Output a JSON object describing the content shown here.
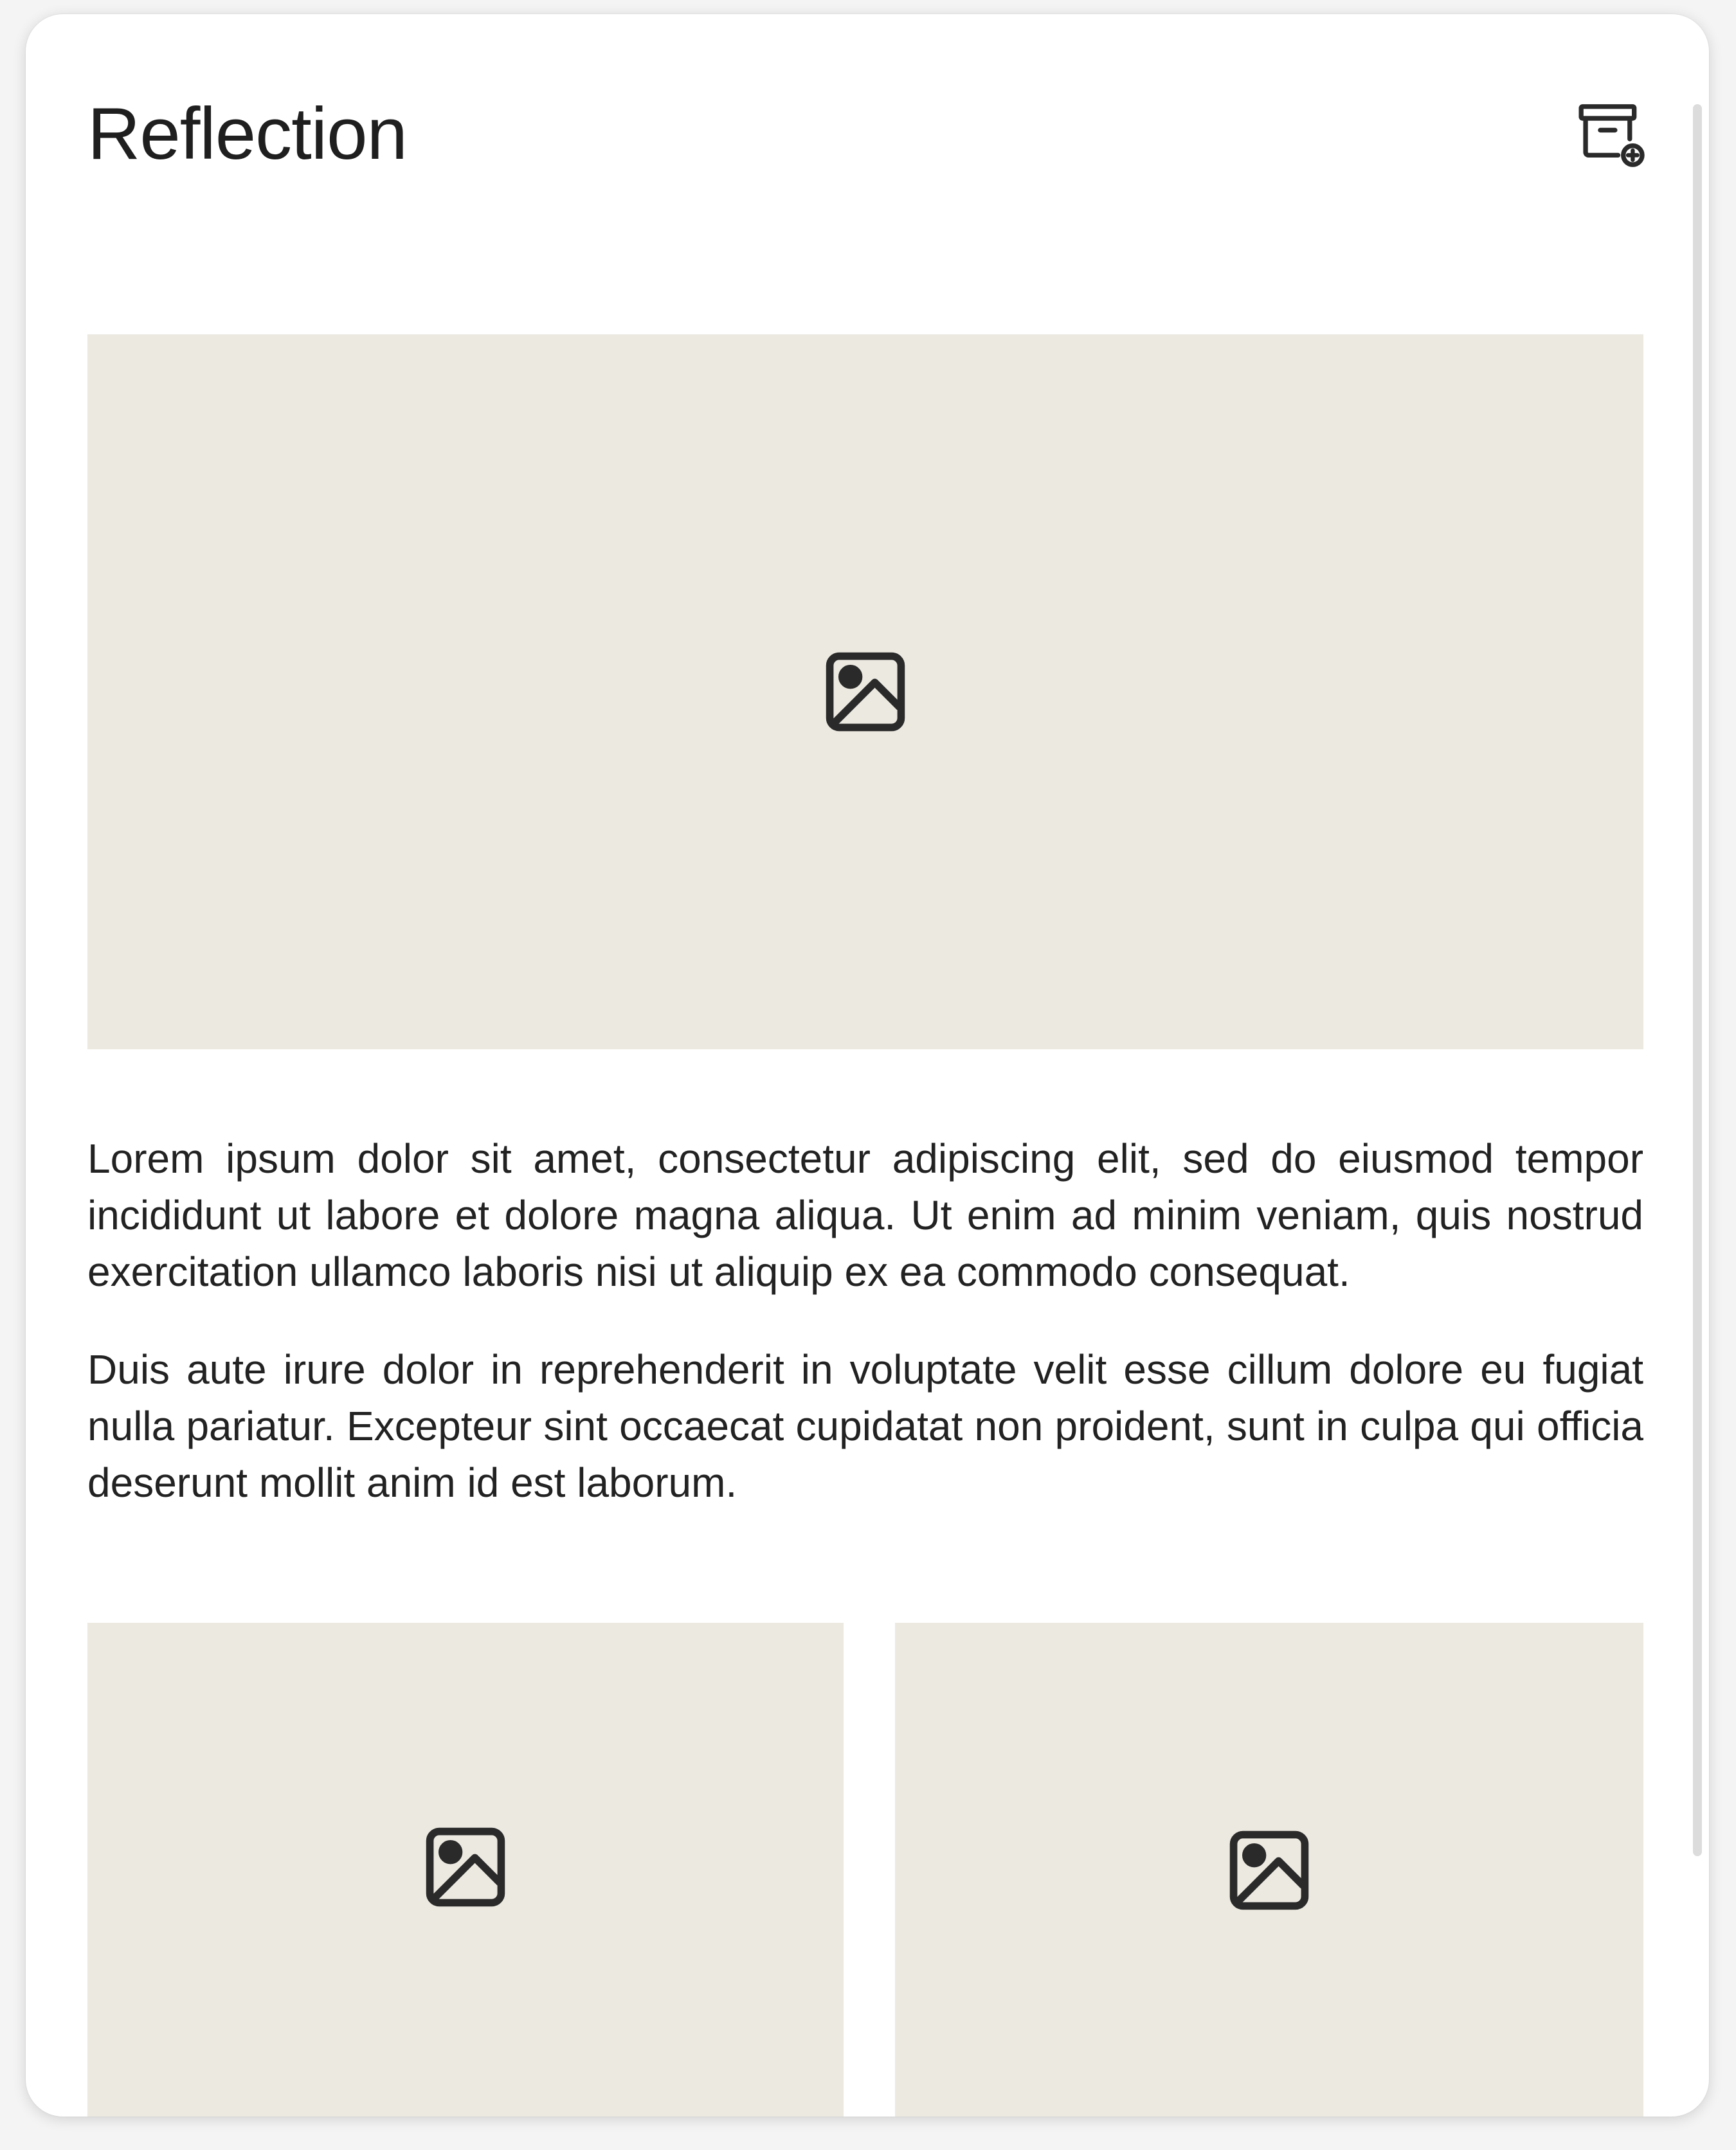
{
  "page": {
    "title": "Reflection"
  },
  "toolbar": {
    "archive_action_icon": "archive-add-icon"
  },
  "content": {
    "hero_image": {
      "icon": "image-placeholder-icon"
    },
    "paragraphs": [
      "Lorem ipsum dolor sit amet, consectetur adipiscing elit, sed do eiusmod tempor incididunt ut labore et dolore magna aliqua. Ut enim ad minim veniam, quis nostrud exercitation ullamco laboris nisi ut aliquip ex ea commodo consequat.",
      "Duis aute irure dolor in reprehenderit in voluptate velit esse cillum dolore eu fugiat nulla pariatur. Excepteur sint occaecat cupidatat non proident, sunt in culpa qui officia deserunt mollit anim id est laborum."
    ],
    "gallery": [
      {
        "icon": "image-placeholder-icon"
      },
      {
        "icon": "image-placeholder-icon"
      }
    ]
  },
  "colors": {
    "placeholder_bg": "#ece9e1",
    "text": "#222222",
    "icon": "#2a2a2a"
  }
}
